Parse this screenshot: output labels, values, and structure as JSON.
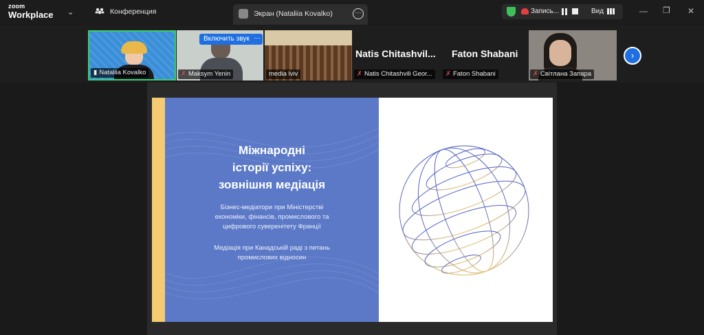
{
  "app": {
    "brand_small": "zoom",
    "brand_large": "Workplace"
  },
  "meeting": {
    "icon": "participants-icon",
    "title": "Конференция"
  },
  "share_tab": {
    "label": "Экран (Nataliia Kovalko)"
  },
  "recording": {
    "label": "Запись...",
    "view_label": "Вид",
    "shield_color": "#3fbf5a",
    "rec_color": "#e04040"
  },
  "participants": [
    {
      "name": "Nataliia Kovalko",
      "pinned": true,
      "muted": false,
      "active": true
    },
    {
      "name": "Maksym Yenin",
      "muted": true
    },
    {
      "name": "media lviv",
      "muted": false
    },
    {
      "name": "Natis Chitashvili Geor...",
      "big_name": "Natis  Chitashvil...",
      "muted": true
    },
    {
      "name": "Faton Shabani",
      "big_name": "Faton Shabani",
      "muted": true
    },
    {
      "name": "Світлана Запара",
      "muted": true
    }
  ],
  "video_controls": {
    "unmute_label": "Включить звук",
    "more_label": "···"
  },
  "slide": {
    "title_lines": [
      "Міжнародні",
      "історії успіху:",
      "зовнішня медіація"
    ],
    "para1_lines": [
      "Бізнес-медіатори при Міністерстві",
      "економіки, фінансів, промислового та",
      "цифрового суверенітету Франції"
    ],
    "para2_lines": [
      "Медіація при Канадській раді з питань",
      "промислових відносин"
    ],
    "colors": {
      "accent_blue": "#5b79c7",
      "accent_yellow": "#f4cb72"
    }
  },
  "accent": "#1f6fe0"
}
